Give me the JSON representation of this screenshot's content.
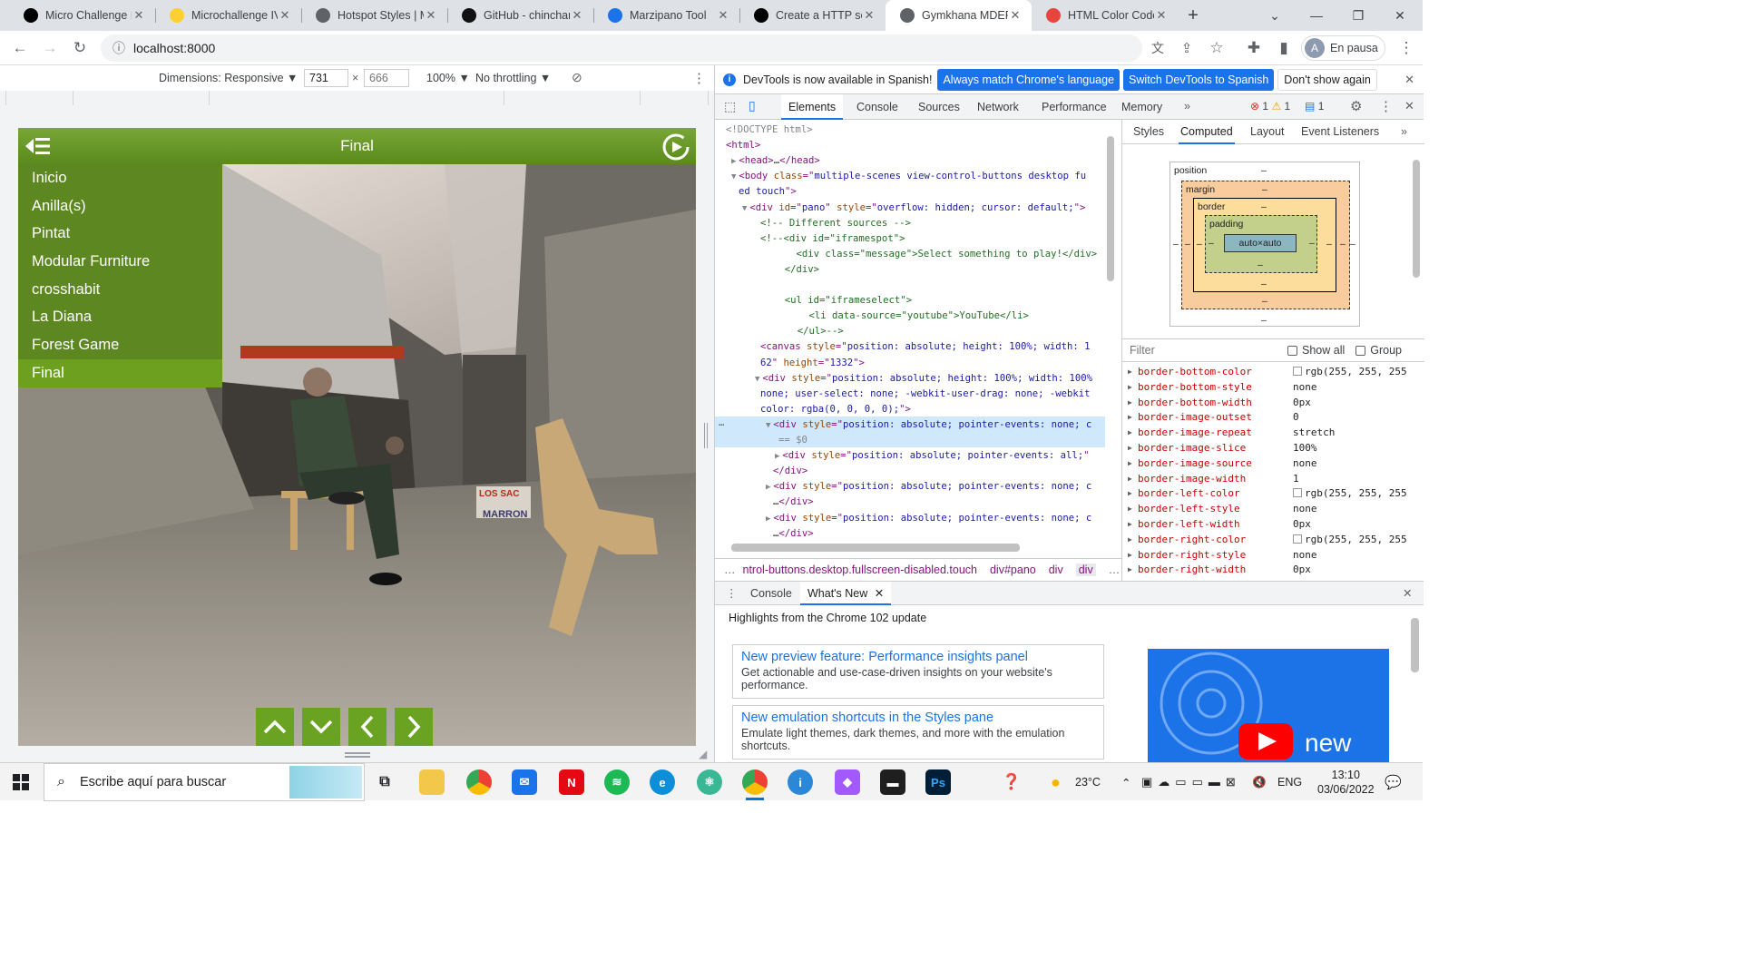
{
  "browser": {
    "tabs": [
      {
        "title": "Micro Challenge I",
        "icon": "fablab-icon"
      },
      {
        "title": "Microchallenge IV",
        "icon": "miro-icon"
      },
      {
        "title": "Hotspot Styles | M",
        "icon": "panorama-icon"
      },
      {
        "title": "GitHub - chinchar",
        "icon": "github-icon"
      },
      {
        "title": "Marzipano Tool",
        "icon": "marzipano-icon"
      },
      {
        "title": "Create a HTTP ser",
        "icon": "devto-icon"
      },
      {
        "title": "Gymkhana MDEF",
        "icon": "panorama-icon",
        "active": true
      },
      {
        "title": "HTML Color Code",
        "icon": "htmlcolor-icon"
      }
    ],
    "url": "localhost:8000",
    "profile_initial": "A",
    "profile_status": "En pausa"
  },
  "device_toolbar": {
    "dimensions_label": "Dimensions: Responsive ▼",
    "width": "731",
    "height_placeholder": "666",
    "zoom": "100% ▼",
    "throttling": "No throttling ▼"
  },
  "page": {
    "header_title": "Final",
    "menu": [
      "Inicio",
      "Anilla(s)",
      "Pintat",
      "Modular Furniture",
      "crosshabit",
      "La Diana",
      "Forest Game",
      "Final"
    ],
    "selected_menu_index": 7,
    "scene_sign_text": "LOS SAC\nMARRON"
  },
  "devtools": {
    "infobar": {
      "message": "DevTools is now available in Spanish!",
      "btn_match": "Always match Chrome's language",
      "btn_switch": "Switch DevTools to Spanish",
      "btn_dismiss": "Don't show again"
    },
    "tabs": [
      "Elements",
      "Console",
      "Sources",
      "Network",
      "Performance",
      "Memory"
    ],
    "active_tab": "Elements",
    "more_tabs": "»",
    "errors": "1",
    "warnings": "1",
    "messages": "1",
    "elements_lines": [
      {
        "parts": [
          [
            "dim",
            "<!DOCTYPE html>"
          ]
        ]
      },
      {
        "parts": [
          [
            "tg",
            "<html>"
          ]
        ]
      },
      {
        "parts": [
          [
            "tri",
            "▶"
          ],
          [
            "tg",
            "<head>"
          ],
          [
            "tx",
            "…"
          ],
          [
            "tg",
            "</head>"
          ]
        ]
      },
      {
        "parts": [
          [
            "tri",
            "▼"
          ],
          [
            "tg",
            "<body "
          ],
          [
            "at",
            "class"
          ],
          [
            "tg",
            "=\""
          ],
          [
            "av",
            "multiple-scenes view-control-buttons desktop fu"
          ]
        ]
      },
      {
        "parts": [
          [
            "av",
            "ed touch"
          ],
          [
            "tg",
            "\">"
          ]
        ]
      },
      {
        "parts": [
          [
            "tri",
            "▼"
          ],
          [
            "tg",
            "<div "
          ],
          [
            "at",
            "id"
          ],
          [
            "tg",
            "=\""
          ],
          [
            "av",
            "pano"
          ],
          [
            "tg",
            "\" "
          ],
          [
            "at",
            "style"
          ],
          [
            "tg",
            "=\""
          ],
          [
            "av",
            "overflow: hidden; cursor: default;"
          ],
          [
            "tg",
            "\">"
          ]
        ]
      },
      {
        "parts": [
          [
            "cm",
            "<!-- Different sources -->"
          ]
        ]
      },
      {
        "parts": [
          [
            "cm",
            "<!--<div id=\"iframespot\">"
          ]
        ]
      },
      {
        "parts": [
          [
            "cm",
            "    <div class=\"message\">Select something to play!</div>"
          ]
        ]
      },
      {
        "parts": [
          [
            "cm",
            "  </div>"
          ]
        ]
      },
      {
        "parts": [
          [
            "cm",
            ""
          ]
        ]
      },
      {
        "parts": [
          [
            "cm",
            "  <ul id=\"iframeselect\">"
          ]
        ]
      },
      {
        "parts": [
          [
            "cm",
            "    <li data-source=\"youtube\">YouTube</li>"
          ]
        ]
      },
      {
        "parts": [
          [
            "cm",
            "  </ul>-->"
          ]
        ]
      },
      {
        "parts": [
          [
            "tg",
            "<canvas "
          ],
          [
            "at",
            "style"
          ],
          [
            "tg",
            "=\""
          ],
          [
            "av",
            "position: absolute; height: 100%; width: 1"
          ]
        ]
      },
      {
        "parts": [
          [
            "av",
            "62"
          ],
          [
            "tg",
            "\" "
          ],
          [
            "at",
            "height"
          ],
          [
            "tg",
            "=\""
          ],
          [
            "av",
            "1332"
          ],
          [
            "tg",
            "\">"
          ]
        ]
      },
      {
        "parts": [
          [
            "tri",
            "▼"
          ],
          [
            "tg",
            "<div "
          ],
          [
            "at",
            "style"
          ],
          [
            "tg",
            "=\""
          ],
          [
            "av",
            "position: absolute; height: 100%; width: 100%"
          ]
        ]
      },
      {
        "parts": [
          [
            "av",
            "none; user-select: none; -webkit-user-drag: none; -webkit"
          ]
        ]
      },
      {
        "parts": [
          [
            "av",
            "color: rgba(0, 0, 0, 0);"
          ],
          [
            "tg",
            "\">"
          ]
        ]
      },
      {
        "parts": [
          [
            "tri",
            "▼"
          ],
          [
            "tg",
            "<div "
          ],
          [
            "at",
            "style"
          ],
          [
            "tg",
            "=\""
          ],
          [
            "av",
            "position: absolute; pointer-events: none; c"
          ]
        ]
      },
      {
        "parts": [
          [
            "dim",
            "== $0"
          ]
        ]
      },
      {
        "parts": [
          [
            "tri",
            "▶"
          ],
          [
            "tg",
            "<div "
          ],
          [
            "at",
            "style"
          ],
          [
            "tg",
            "=\""
          ],
          [
            "av",
            "position: absolute; pointer-events: all;"
          ],
          [
            "tg",
            "\""
          ]
        ]
      },
      {
        "parts": [
          [
            "tg",
            "</div>"
          ]
        ]
      },
      {
        "parts": [
          [
            "tri",
            "▶"
          ],
          [
            "tg",
            "<div "
          ],
          [
            "at",
            "style"
          ],
          [
            "tg",
            "=\""
          ],
          [
            "av",
            "position: absolute; pointer-events: none; c"
          ]
        ]
      },
      {
        "parts": [
          [
            "tx",
            "…"
          ],
          [
            "tg",
            "</div>"
          ]
        ]
      },
      {
        "parts": [
          [
            "tri",
            "▶"
          ],
          [
            "tg",
            "<div "
          ],
          [
            "at",
            "style"
          ],
          [
            "tg",
            "=\""
          ],
          [
            "av",
            "position: absolute; pointer-events: none; c"
          ]
        ]
      },
      {
        "parts": [
          [
            "tx",
            "…"
          ],
          [
            "tg",
            "</div>"
          ]
        ]
      }
    ],
    "breadcrumbs": [
      "…",
      "ntrol-buttons.desktop.fullscreen-disabled.touch",
      "div#pano",
      "div",
      "div",
      "…"
    ],
    "sidebar_tabs": [
      "Styles",
      "Computed",
      "Layout",
      "Event Listeners"
    ],
    "sidebar_active": "Computed",
    "box_model": {
      "position_label": "position",
      "margin_label": "margin",
      "border_label": "border",
      "padding_label": "padding",
      "content": "auto×auto",
      "dash": "–"
    },
    "filter_placeholder": "Filter",
    "show_all": "Show all",
    "group": "Group",
    "computed": [
      {
        "name": "border-bottom-color",
        "value": "rgb(255, 255, 255",
        "swatch": true
      },
      {
        "name": "border-bottom-style",
        "value": "none"
      },
      {
        "name": "border-bottom-width",
        "value": "0px"
      },
      {
        "name": "border-image-outset",
        "value": "0"
      },
      {
        "name": "border-image-repeat",
        "value": "stretch"
      },
      {
        "name": "border-image-slice",
        "value": "100%"
      },
      {
        "name": "border-image-source",
        "value": "none"
      },
      {
        "name": "border-image-width",
        "value": "1"
      },
      {
        "name": "border-left-color",
        "value": "rgb(255, 255, 255",
        "swatch": true
      },
      {
        "name": "border-left-style",
        "value": "none"
      },
      {
        "name": "border-left-width",
        "value": "0px"
      },
      {
        "name": "border-right-color",
        "value": "rgb(255, 255, 255",
        "swatch": true
      },
      {
        "name": "border-right-style",
        "value": "none"
      },
      {
        "name": "border-right-width",
        "value": "0px"
      }
    ],
    "drawer": {
      "tabs": [
        "Console",
        "What's New"
      ],
      "active": "What's New",
      "highlights": "Highlights from the Chrome 102 update",
      "cards": [
        {
          "title": "New preview feature: Performance insights panel",
          "desc": "Get actionable and use-case-driven insights on your website's performance."
        },
        {
          "title": "New emulation shortcuts in the Styles pane",
          "desc": "Emulate light themes, dark themes, and more with the emulation shortcuts."
        }
      ],
      "video_text": "new"
    }
  },
  "taskbar": {
    "search_placeholder": "Escribe aquí para buscar",
    "temperature": "23°C",
    "language": "ENG",
    "time": "13:10",
    "date": "03/06/2022"
  },
  "colors": {
    "accent_green": "#6aa321",
    "devtools_blue": "#1a73e8"
  }
}
